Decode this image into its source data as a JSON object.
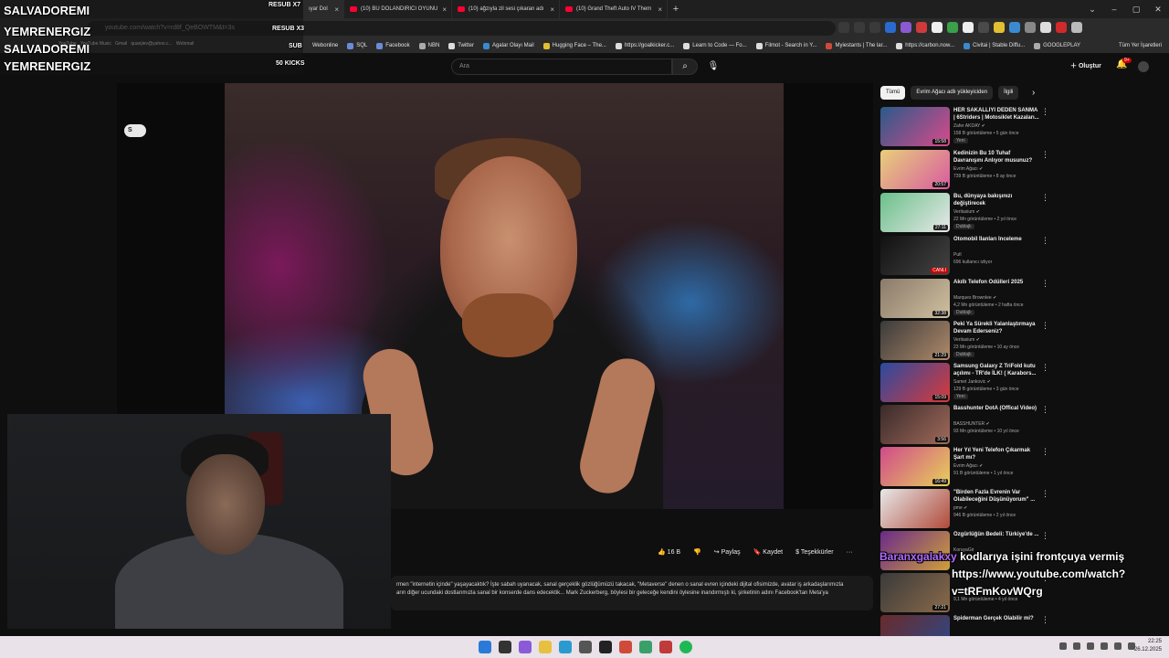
{
  "tabs": [
    {
      "label": "ıyar Dol",
      "active": true
    },
    {
      "label": "(10) BU DOLANDIRICI OYUNU"
    },
    {
      "label": "(10) ağzıyla zil sesi çıkaran adı"
    },
    {
      "label": "(10) Grand Theft Auto IV Them"
    }
  ],
  "address": {
    "url": "youtube.com/watch?v=rd8f_QeBOWTM&t=3s"
  },
  "bookmarks": [
    "Webonline",
    "SQL",
    "Facebook",
    "NBN",
    "Twitter",
    "Agalar Olayı Mail",
    "Hugging Face – The...",
    "https://goalkicker.c...",
    "Learn to Code — Fo...",
    "Filmot - Search in Y...",
    "Myiestants | The lar...",
    "https://carbon.now...",
    "Civitai | Stable Diffu...",
    "GOOGLEPLAY"
  ],
  "bookmarks_right": "Tüm Yer İşaretleri",
  "overlay": {
    "names": [
      "SALVADOREMI",
      "YEMRENERGIZ",
      "SALVADOREMI",
      "YEMRENERGIZ"
    ],
    "resub_x7": "RESUB X7",
    "resub_x3": "RESUB X3",
    "sub": "SUB",
    "kicks": "50 KICKS",
    "faded_youtube": "YouTube",
    "faded_music": "YouTube Music",
    "faded_gmail": "Gmail",
    "faded_mail": "quanjiev@yahoo.c...",
    "faded_webmail": "Webmail"
  },
  "yt": {
    "search_placeholder": "Ara",
    "create": "Oluştur",
    "notifications": "9+"
  },
  "player": {
    "pill": "S"
  },
  "actions": {
    "like": "16 B",
    "share": "Paylaş",
    "save": "Kaydet",
    "thanks": "Teşekkürler",
    "more": "···"
  },
  "description": {
    "line1": "rmen \"internetin içinde\" yaşayacaktık? İşte sabah uyanacak, sanal gerçeklik gözlüğümüzü takacak, \"Metaverse\" denen o sanal evren içindeki dijital ofisimizde, avatar iş arkadaşlarımızla",
    "line2": "arın diğer ucundaki dostlarımızla sanal bir konserde dans edecektik... Mark Zuckerberg, böylesi bir geleceğe kendini öylesine inandırmıştı ki, şirketinin adını Facebook'tan Meta'ya"
  },
  "chips": [
    "Tümü",
    "Evrim Ağacı adlı yükleyiciden",
    "İlgili"
  ],
  "recommendations": [
    {
      "title": "HER SAKALLIYI DEDEN SANMA | 6Striders | Motosiklet Kazaları...",
      "channel": "Zafer AKDAY ✔",
      "meta": "158 B görüntüleme • 5 gün önce",
      "badge": "Yeni",
      "duration": "15:58",
      "c1": "#2a5a8a",
      "c2": "#d94a8a"
    },
    {
      "title": "Kedinizin Bu 10 Tuhaf Davranışını Anlıyor musunuz?",
      "channel": "Evrim Ağacı ✔",
      "meta": "739 B görüntüleme • 8 ay önce",
      "badge": "",
      "duration": "20:57",
      "c1": "#e8d07a",
      "c2": "#d95aa0"
    },
    {
      "title": "Bu, dünyaya bakışınızı değiştirecek",
      "channel": "Veritasium ✔",
      "meta": "22 Mn görüntüleme • 2 yıl önce",
      "badge": "Dublajlı",
      "duration": "27:11",
      "c1": "#6ac08a",
      "c2": "#e8e8e8"
    },
    {
      "title": "Otomobil İlanları İnceleme",
      "channel": "Pufi",
      "meta": "696 kullanıcı izliyor",
      "badge": "",
      "live": "CANLI",
      "c1": "#111111",
      "c2": "#444444"
    },
    {
      "title": "Akıllı Telefon Ödülleri 2025",
      "channel": "Marques Brownlee ✔",
      "meta": "4,2 Mn görüntüleme • 2 hafta önce",
      "badge": "Dublajlı",
      "duration": "32:38",
      "c1": "#8a7a6a",
      "c2": "#d0c0a0"
    },
    {
      "title": "Peki Ya Sürekli Yalanlaştırmaya Devam Ederseniz?",
      "channel": "Veritasium ✔",
      "meta": "23 Mn görüntüleme • 10 ay önce",
      "badge": "Dublajlı",
      "duration": "21:29",
      "c1": "#3a3a3a",
      "c2": "#b08a6a"
    },
    {
      "title": "Samsung Galaxy Z TriFold kutu açılımı - TR'de İLK! ( Karabors...",
      "channel": "Samet Jankovic ✔",
      "meta": "129 B görüntüleme • 3 gün önce",
      "badge": "Yeni",
      "duration": "15:09",
      "c1": "#2a4aa0",
      "c2": "#d93a3a"
    },
    {
      "title": "Basshunter DotA (Offical Video)",
      "channel": "BASSHUNTER ✔",
      "meta": "93 Mn görüntüleme • 10 yıl önce",
      "badge": "",
      "duration": "3:56",
      "c1": "#3a2a2a",
      "c2": "#a06a5a"
    },
    {
      "title": "Her Yıl Yeni Telefon Çıkarmak Şart mı?",
      "channel": "Evrim Ağacı ✔",
      "meta": "91 B görüntüleme • 1 yıl önce",
      "badge": "",
      "duration": "16:49",
      "c1": "#d04a8a",
      "c2": "#e8d05a"
    },
    {
      "title": "\"Birden Fazla Evrenin Var Olabileceğini Düşünüyorum\" ...",
      "channel": "pme ✔",
      "meta": "946 B görüntüleme • 2 yıl önce",
      "badge": "",
      "duration": "",
      "c1": "#e8e8e8",
      "c2": "#b04a3a"
    },
    {
      "title": "Özgürlüğün Bedeli: Türkiye'de ...",
      "channel": "KoruyaGir",
      "meta": "",
      "badge": "",
      "duration": "",
      "c1": "#6a2a8a",
      "c2": "#d0a03a"
    },
    {
      "title": "",
      "channel": "EXXEN",
      "meta": "9,1 Mn görüntüleme • 4 yıl önce",
      "badge": "",
      "duration": "27:21",
      "c1": "#3a3a3a",
      "c2": "#8a6a4a"
    },
    {
      "title": "Spiderman Gerçek Olabilir mi?",
      "channel": "",
      "meta": "",
      "badge": "",
      "duration": "",
      "c1": "#6a2a2a",
      "c2": "#2a4a8a"
    }
  ],
  "chat": {
    "user": "Baranxgalakxy",
    "message_1": "kodlarıya işini frontçuya vermiş",
    "message_2": "https://www.youtube.com/watch?",
    "message_3": "v=tRFmKovWQrg"
  },
  "taskbar": {
    "time": "22:25",
    "date": "26.12.2025"
  }
}
